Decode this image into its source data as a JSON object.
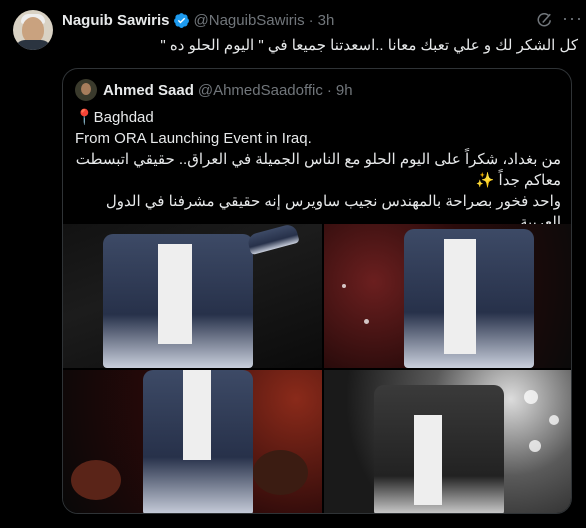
{
  "tweet": {
    "author_name": "Naguib Sawiris",
    "author_handle": "@NaguibSawiris",
    "separator": "·",
    "time": "3h",
    "text": "كل الشكر لك و علي تعبك معانا ..اسعدتنا جميعا في \" اليوم الحلو ده \"",
    "more_label": "···"
  },
  "quote": {
    "author_name": "Ahmed Saad",
    "author_handle": "@AhmedSaadoffic",
    "separator": "·",
    "time": "9h",
    "location": "📍Baghdad",
    "line_en": "From ORA Launching Event in Iraq.",
    "line_ar_1": "من بغداد، شكراً على اليوم الحلو مع الناس الجميلة في العراق.. حقيقي اتبسطت",
    "line_ar_2": "معاكم جداً ✨",
    "line_ar_3": "واحد فخور بصراحة بالمهندس نجيب ساويرس إنه حقيقي مشرفنا في الدول العربية..."
  },
  "colors": {
    "verified": "#1d9bf0",
    "muted": "#71767b",
    "border": "#2f3336"
  }
}
